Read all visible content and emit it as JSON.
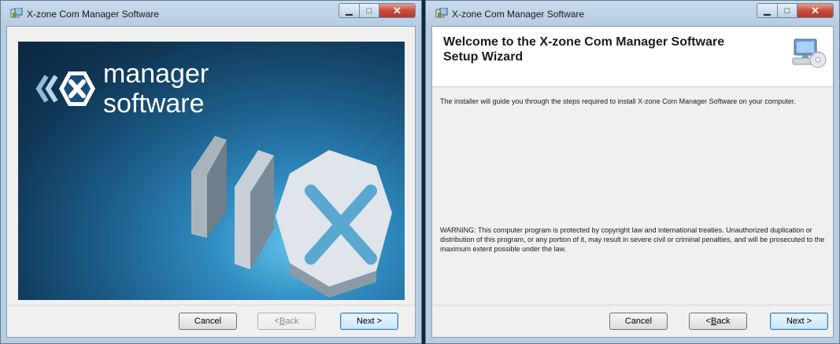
{
  "window1": {
    "title": "X-zone Com Manager Software",
    "banner": {
      "brand_line1": "manager",
      "brand_line2": "software"
    },
    "buttons": {
      "cancel": "Cancel",
      "back_prefix": "< ",
      "back_mnemonic": "B",
      "back_rest": "ack",
      "next": "Next >"
    }
  },
  "window2": {
    "title": "X-zone Com Manager Software",
    "header_title": "Welcome to the X-zone Com Manager Software Setup Wizard",
    "intro": "The installer will guide you through the steps required to install X-zone Com Manager Software on your computer.",
    "warning": "WARNING: This computer program is protected by copyright law and international treaties. Unauthorized duplication or distribution of this program, or any portion of it, may result in severe civil or criminal penalties, and will be prosecuted to the maximum extent possible under the law.",
    "buttons": {
      "cancel": "Cancel",
      "back_prefix": "< ",
      "back_mnemonic": "B",
      "back_rest": "ack",
      "next": "Next >"
    }
  },
  "icons": {
    "app": "installer-icon",
    "minimize": "minimize-icon",
    "maximize": "maximize-icon",
    "close": "close-icon",
    "logo": "x-hexagon-logo-icon",
    "computer": "computer-install-icon"
  },
  "colors": {
    "banner_dark": "#0b2740",
    "banner_light": "#62c3ea",
    "close_button": "#c74c3a",
    "default_button_border": "#3c7fb1"
  },
  "state": {
    "back_button_window1": "disabled",
    "back_button_window2": "enabled"
  }
}
